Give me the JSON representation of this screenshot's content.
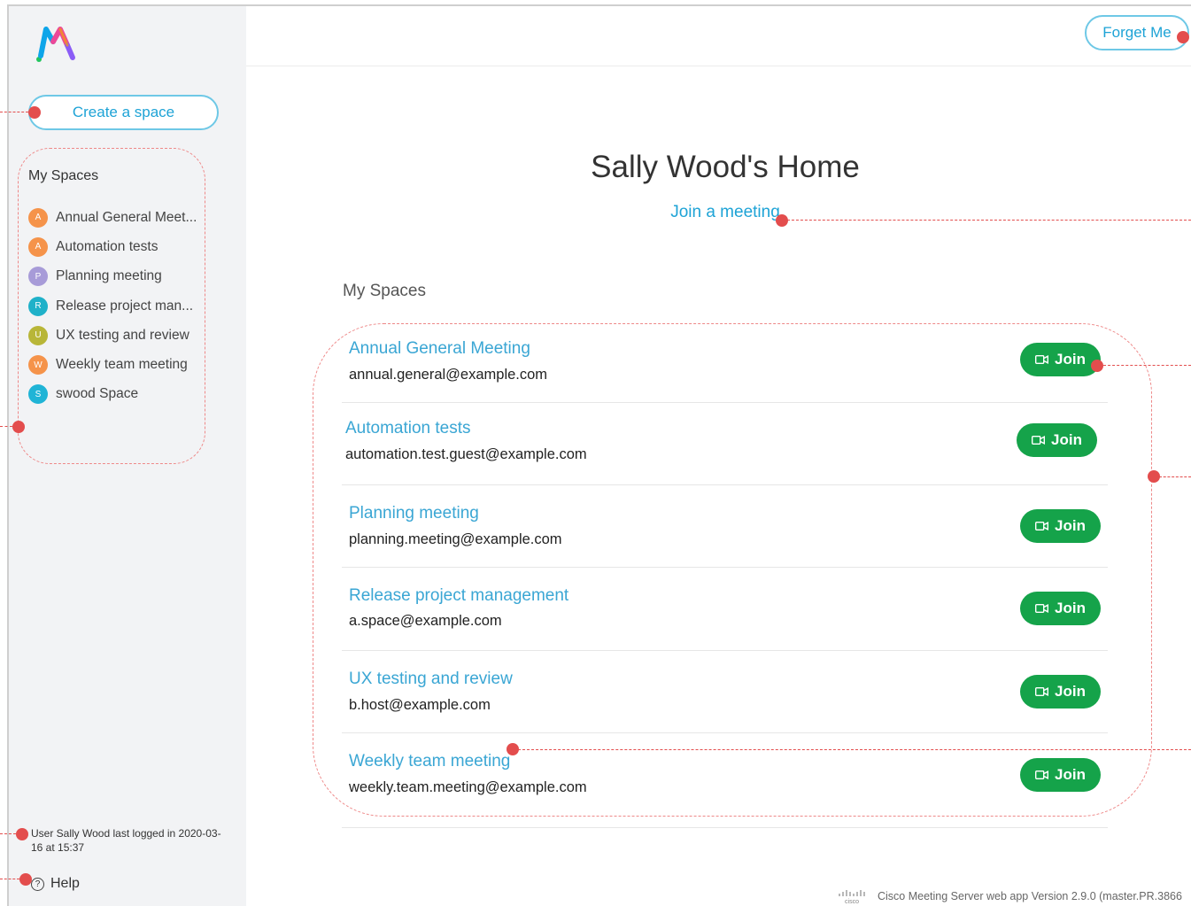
{
  "app": {
    "logo_label": "M",
    "forget_me_label": "Forget Me"
  },
  "sidebar": {
    "create_space_label": "Create a space",
    "heading": "My Spaces",
    "items": [
      {
        "initial": "A",
        "label": "Annual General Meet...",
        "color": "#f5934a"
      },
      {
        "initial": "A",
        "label": "Automation tests",
        "color": "#f5934a"
      },
      {
        "initial": "P",
        "label": "Planning meeting",
        "color": "#a79bd8"
      },
      {
        "initial": "R",
        "label": "Release project man...",
        "color": "#1fb1c9"
      },
      {
        "initial": "U",
        "label": "UX testing and review",
        "color": "#b8b638"
      },
      {
        "initial": "W",
        "label": "Weekly team meeting",
        "color": "#f5934a"
      },
      {
        "initial": "S",
        "label": "swood Space",
        "color": "#20b4d6"
      }
    ],
    "last_login": "User Sally Wood last logged in 2020-03-16 at 15:37",
    "help_label": "Help"
  },
  "main": {
    "title": "Sally Wood's Home",
    "join_meeting_label": "Join a meeting",
    "spaces_heading": "My Spaces",
    "spaces": [
      {
        "name": "Annual General Meeting",
        "email": "annual.general@example.com",
        "join_label": "Join"
      },
      {
        "name": "Automation tests",
        "email": "automation.test.guest@example.com",
        "join_label": "Join"
      },
      {
        "name": "Planning meeting",
        "email": "planning.meeting@example.com",
        "join_label": "Join"
      },
      {
        "name": "Release project management",
        "email": "a.space@example.com",
        "join_label": "Join"
      },
      {
        "name": "UX testing and review",
        "email": "b.host@example.com",
        "join_label": "Join"
      },
      {
        "name": "Weekly team meeting",
        "email": "weekly.team.meeting@example.com",
        "join_label": "Join"
      }
    ]
  },
  "footer": {
    "cisco_label": "cisco",
    "version_text": "Cisco Meeting Server web app Version 2.9.0 (master.PR.3866"
  },
  "colors": {
    "accent": "#1ea3d6",
    "join_green": "#15a34a",
    "annotation_red": "#e34d4d",
    "sidebar_bg": "#f2f3f5"
  }
}
